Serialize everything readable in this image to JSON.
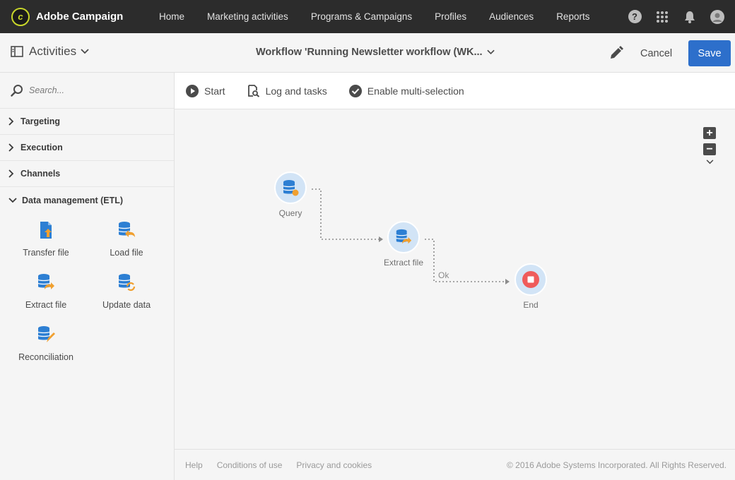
{
  "brand": {
    "name": "Adobe Campaign"
  },
  "nav": {
    "items": [
      "Home",
      "Marketing activities",
      "Programs & Campaigns",
      "Profiles",
      "Audiences",
      "Reports"
    ]
  },
  "header": {
    "activities_label": "Activities",
    "workflow_title": "Workflow 'Running Newsletter workflow (WK...",
    "cancel_label": "Cancel",
    "save_label": "Save"
  },
  "sidebar": {
    "search_placeholder": "Search...",
    "categories": [
      "Targeting",
      "Execution",
      "Channels",
      "Data management (ETL)"
    ],
    "activities": [
      "Transfer file",
      "Load file",
      "Extract file",
      "Update data",
      "Reconciliation"
    ]
  },
  "toolbar": {
    "start_label": "Start",
    "log_label": "Log and tasks",
    "multi_label": "Enable multi-selection"
  },
  "canvas": {
    "nodes": [
      "Query",
      "Extract file",
      "End"
    ],
    "link_label": "Ok"
  },
  "footer": {
    "links": [
      "Help",
      "Conditions of use",
      "Privacy and cookies"
    ],
    "copyright": "© 2016 Adobe Systems Incorporated. All Rights Reserved."
  },
  "colors": {
    "accent": "#2d6fcb",
    "topnav": "#2c2c2c",
    "node_fill": "#d2e4f6",
    "end_red": "#ef5b5b",
    "icon_blue": "#2d7fd3",
    "icon_orange": "#f0a030"
  }
}
